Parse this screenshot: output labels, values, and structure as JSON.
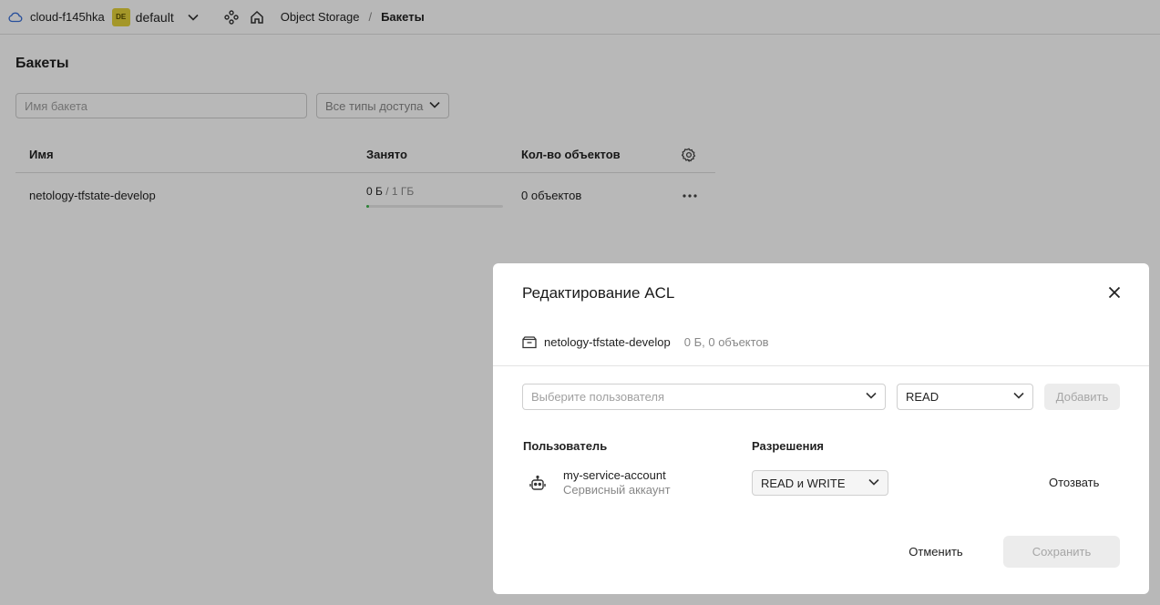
{
  "header": {
    "cloud": "cloud-f145hka",
    "folder_badge": "DE",
    "folder": "default",
    "breadcrumb": [
      "Object Storage",
      "Бакеты"
    ],
    "breadcrumb_sep": "/"
  },
  "page": {
    "title": "Бакеты",
    "search_placeholder": "Имя бакета",
    "access_filter": "Все типы доступа"
  },
  "table": {
    "columns": [
      "Имя",
      "Занято",
      "Кол-во объектов"
    ],
    "rows": [
      {
        "name": "netology-tfstate-develop",
        "used": "0 Б",
        "total": " / 1 ГБ",
        "usage_fraction": 0.0,
        "objects": "0 объектов"
      }
    ]
  },
  "modal": {
    "title": "Редактирование ACL",
    "bucket_name": "netology-tfstate-develop",
    "bucket_meta": "0 Б, 0 объектов",
    "user_placeholder": "Выберите пользователя",
    "permission_value": "READ",
    "add_label": "Добавить",
    "col_user": "Пользователь",
    "col_permissions": "Разрешения",
    "entries": [
      {
        "name": "my-service-account",
        "type": "Сервисный аккаунт",
        "permission": "READ и WRITE",
        "revoke": "Отозвать"
      }
    ],
    "cancel_label": "Отменить",
    "save_label": "Сохранить"
  },
  "colors": {
    "accent_badge": "#e4d23a",
    "usage_fill": "#3bb54a",
    "overlay": "rgba(0,0,0,0.28)"
  }
}
